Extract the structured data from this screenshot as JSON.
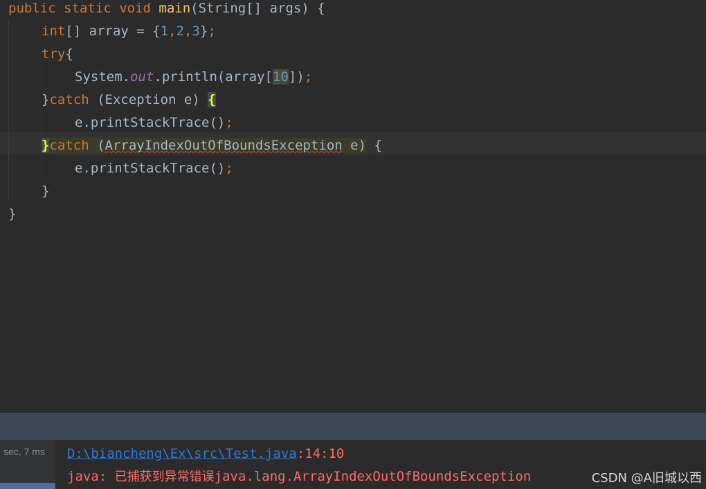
{
  "code": {
    "l1_kw1": "public",
    "l1_kw2": "static",
    "l1_kw3": "void",
    "l1_fn": "main",
    "l1_rest": "(String[] args) {",
    "l2_kw": "int",
    "l2_a": "[] array = {",
    "l2_n1": "1",
    "l2_c1": ",",
    "l2_n2": "2",
    "l2_c2": ",",
    "l2_n3": "3",
    "l2_b": "}",
    "l2_semi": ";",
    "l3_kw": "try",
    "l3_b": "{",
    "l4_a": "System.",
    "l4_out": "out",
    "l4_b": ".println(array[",
    "l4_num": "10",
    "l4_c": "])",
    "l4_semi": ";",
    "l5_b": "}",
    "l5_kw": "catch",
    "l5_a": " (Exception e) ",
    "l5_brace": "{",
    "l6_a": "e.printStackTrace()",
    "l6_semi": ";",
    "l7_b": "}",
    "l7_kw": "catch",
    "l7_a": " (",
    "l7_ex": "ArrayIndexOutOfBoundsException",
    "l7_c": " e)",
    "l7_d": " {",
    "l8_a": "e.printStackTrace()",
    "l8_semi": ";",
    "l9_b": "}",
    "l10_b": "}"
  },
  "console": {
    "gutter_text": "sec, 7 ms",
    "path_link": "D:\\biancheng\\Ex\\src\\Test.java",
    "path_pos": ":14:10",
    "error_prefix": "java: ",
    "error_cn": "已捕获到异常错误",
    "error_class": "java.lang.ArrayIndexOutOfBoundsException"
  },
  "watermark": "CSDN @A旧城以西"
}
